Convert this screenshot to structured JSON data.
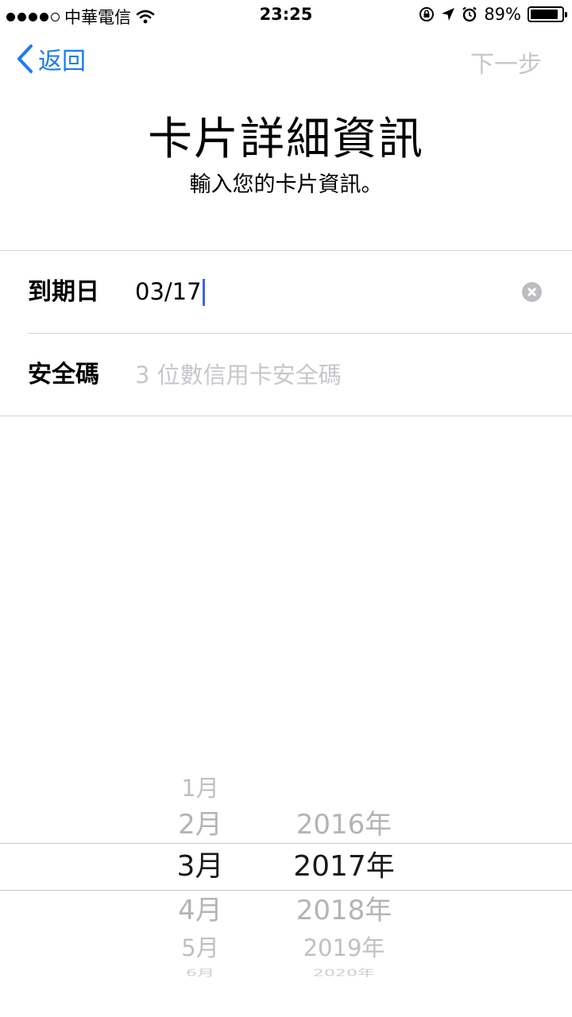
{
  "status_bar": {
    "carrier": "中華電信",
    "time": "23:25",
    "battery_percent": "89%",
    "battery_level": 0.89,
    "icons": [
      "signal-dots-icon",
      "wifi-icon",
      "rotation-lock-icon",
      "location-arrow-icon",
      "alarm-icon",
      "battery-icon"
    ]
  },
  "nav": {
    "back_label": "返回",
    "next_label": "下一步"
  },
  "header": {
    "title": "卡片詳細資訊",
    "subtitle": "輸入您的卡片資訊。"
  },
  "form": {
    "expiry": {
      "label": "到期日",
      "value": "03/17"
    },
    "security": {
      "label": "安全碼",
      "value": "",
      "placeholder": "3 位數信用卡安全碼"
    }
  },
  "picker": {
    "months": [
      "1月",
      "2月",
      "3月",
      "4月",
      "5月",
      "6月"
    ],
    "years": [
      "2016年",
      "2017年",
      "2018年",
      "2019年",
      "2020年"
    ],
    "selected_month": "3月",
    "selected_year": "2017年"
  },
  "colors": {
    "accent": "#1a7cf0",
    "disabled": "#c7c7cc",
    "caret": "#3b64f0",
    "separator": "#d4d4d8"
  }
}
